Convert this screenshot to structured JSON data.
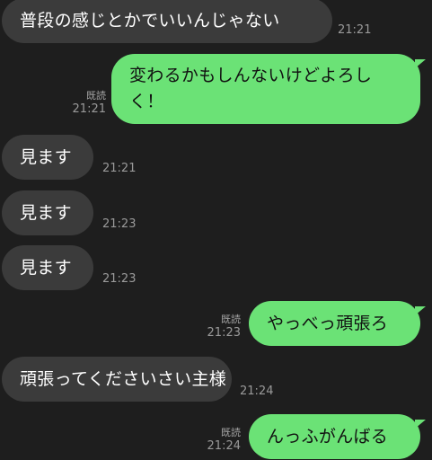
{
  "messages": [
    {
      "side": "in",
      "text": "普段の感じとかでいいんじゃない",
      "time": "21:21",
      "read": ""
    },
    {
      "side": "out",
      "text": "変わるかもしんないけどよろしく！",
      "time": "21:21",
      "read": "既読"
    },
    {
      "side": "in",
      "text": "見ます",
      "time": "21:21",
      "read": ""
    },
    {
      "side": "in",
      "text": "見ます",
      "time": "21:23",
      "read": ""
    },
    {
      "side": "in",
      "text": "見ます",
      "time": "21:23",
      "read": ""
    },
    {
      "side": "out",
      "text": "やっべっ頑張ろ",
      "time": "21:23",
      "read": "既読"
    },
    {
      "side": "in",
      "text": "頑張ってくださいさい主様",
      "time": "21:24",
      "read": ""
    },
    {
      "side": "out",
      "text": "んっふがんばる",
      "time": "21:24",
      "read": "既読"
    }
  ],
  "colors": {
    "background": "#1e1e1e",
    "incoming_bubble": "#3b3b3b",
    "outgoing_bubble": "#6be276"
  }
}
